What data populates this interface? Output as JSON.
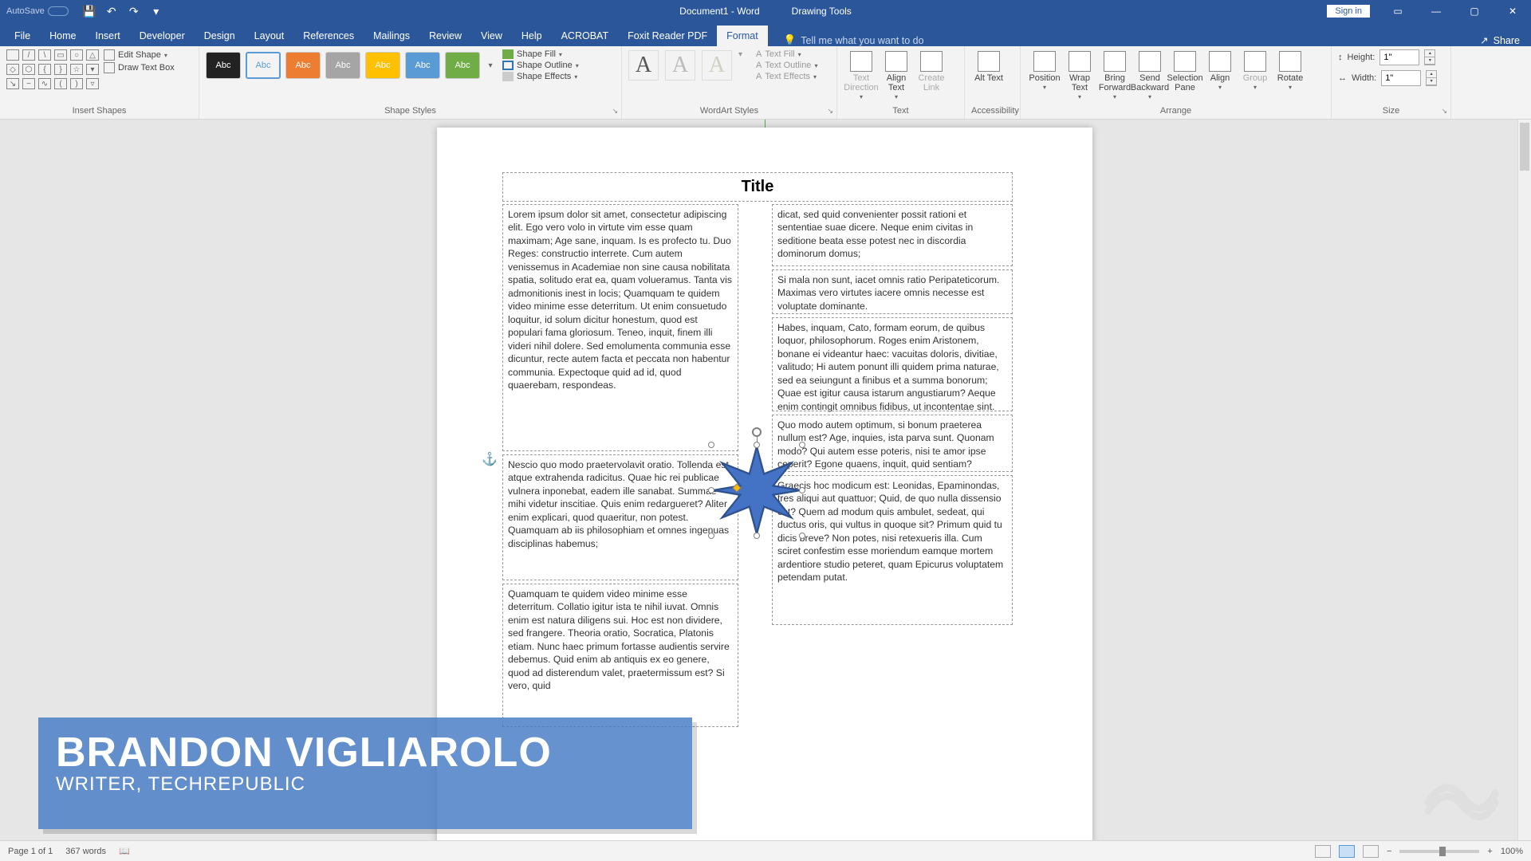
{
  "titlebar": {
    "autosave": "AutoSave",
    "doc_title": "Document1 - Word",
    "context": "Drawing Tools",
    "signin": "Sign in"
  },
  "tabs": {
    "file": "File",
    "home": "Home",
    "insert": "Insert",
    "developer": "Developer",
    "design": "Design",
    "layout": "Layout",
    "references": "References",
    "mailings": "Mailings",
    "review": "Review",
    "view": "View",
    "help": "Help",
    "acrobat": "ACROBAT",
    "foxit": "Foxit Reader PDF",
    "format": "Format",
    "tellme": "Tell me what you want to do",
    "share": "Share"
  },
  "groups": {
    "insert_shapes": "Insert Shapes",
    "edit_shape": "Edit Shape",
    "draw_text": "Draw Text Box",
    "shape_styles": "Shape Styles",
    "shape_fill": "Shape Fill",
    "shape_outline": "Shape Outline",
    "shape_effects": "Shape Effects",
    "wordart": "WordArt Styles",
    "text_fill": "Text Fill",
    "text_outline": "Text Outline",
    "text_effects": "Text Effects",
    "text": "Text",
    "text_dir": "Text Direction",
    "align_text": "Align Text",
    "create_link": "Create Link",
    "alt_text": "Alt Text",
    "accessibility": "Accessibility",
    "arrange": "Arrange",
    "position": "Position",
    "wrap": "Wrap Text",
    "bring": "Bring Forward",
    "send": "Send Backward",
    "selpane": "Selection Pane",
    "align": "Align",
    "group": "Group",
    "rotate": "Rotate",
    "size": "Size",
    "height": "Height:",
    "width": "Width:",
    "size_val": "1\"",
    "abc": "Abc"
  },
  "doc": {
    "title": "Title",
    "p1": "Lorem ipsum dolor sit amet, consectetur adipiscing elit. Ego vero volo in virtute vim esse quam maximam; Age sane, inquam. Is es profecto tu. Duo Reges: constructio interrete. Cum autem venissemus in Academiae non sine causa nobilitata spatia, solitudo erat ea, quam volueramus. Tanta vis admonitionis inest in locis; Quamquam te quidem video minime esse deterritum. Ut enim consuetudo loquitur, id solum dicitur honestum, quod est populari fama gloriosum. Teneo, inquit, finem illi videri nihil dolere. Sed emolumenta communia esse dicuntur, recte autem facta et peccata non habentur communia. Expectoque quid ad id, quod quaerebam, respondeas.",
    "p2": "Nescio quo modo praetervolavit oratio. Tollenda est atque extrahenda radicitus. Quae hic rei publicae vulnera inponebat, eadem ille sanabat. Summae mihi videtur inscitiae. Quis enim redargueret? Aliter enim explicari, quod quaeritur, non potest. Quamquam ab iis philosophiam et omnes ingenuas disciplinas habemus;",
    "p3": "Quamquam te quidem video minime esse deterritum. Collatio igitur ista te nihil iuvat. Omnis enim est natura diligens sui. Hoc est non dividere, sed frangere. Theoria oratio, Socratica, Platonis etiam. Nunc haec primum fortasse audientis servire debemus. Quid enim ab antiquis ex eo genere, quod ad disterendum valet, praetermissum est? Si vero, quid",
    "p4": "dicat, sed quid convenienter possit rationi et sententiae suae dicere. Neque enim civitas in seditione beata esse potest nec in discordia dominorum domus;",
    "p5": "Si mala non sunt, iacet omnis ratio Peripateticorum. Maximas vero virtutes iacere omnis necesse est voluptate dominante.",
    "p6": "Habes, inquam, Cato, formam eorum, de quibus loquor, philosophorum. Roges enim Aristonem, bonane ei videantur haec: vacuitas doloris, divitiae, valitudo; Hi autem ponunt illi quidem prima naturae, sed ea seiungunt a finibus et a summa bonorum; Quae est igitur causa istarum angustiarum? Aeque enim contingit omnibus fidibus, ut incontentae sint.",
    "p7": "Quo modo autem optimum, si bonum praeterea nullum est? Age, inquies, ista parva sunt. Quonam modo? Qui autem esse poteris, nisi te amor ipse ceperit? Egone quaens, inquit, quid sentiam?",
    "p8": "Graecis hoc modicum est: Leonidas, Epaminondas, tres aliqui aut quattuor; Quid, de quo nulla dissensio est? Quem ad modum quis ambulet, sedeat, qui ductus oris, qui vultus in quoque sit? Primum quid tu dicis breve? Non potes, nisi retexueris illa. Cum sciret confestim esse moriendum eamque mortem ardentiore studio peteret, quam Epicurus voluptatem petendam putat."
  },
  "overlay": {
    "name": "BRANDON VIGLIAROLO",
    "role": "WRITER, TECHREPUBLIC"
  },
  "status": {
    "page": "Page 1 of 1",
    "words": "367 words",
    "zoom": "100%"
  }
}
